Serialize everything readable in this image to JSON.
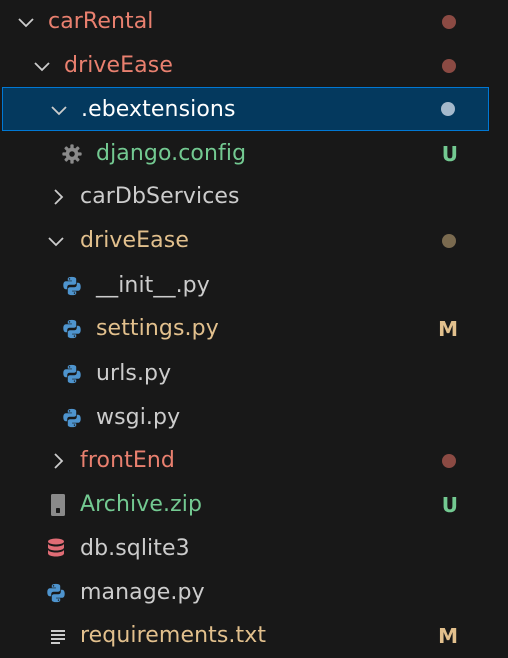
{
  "colors": {
    "background": "#181818",
    "text_default": "#cccccc",
    "text_conflict": "#e9806f",
    "text_modified": "#e2c08d",
    "text_untracked": "#73c991",
    "dot_conflict": "#8b4a43",
    "dot_modified": "#7a6a4f",
    "dot_selected": "#a5b9cc",
    "selection_bg": "#04395e",
    "selection_border": "#0078d4",
    "chevron": "#cccccc",
    "python_icon": "#4e94ce",
    "database_icon": "#e06c75"
  },
  "explorer": {
    "items": [
      {
        "label": "carRental",
        "kind": "folder",
        "expanded": true,
        "status": "conflict-dot",
        "icon": "chevron-down-icon"
      },
      {
        "label": "driveEase",
        "kind": "folder",
        "expanded": true,
        "status": "conflict-dot",
        "icon": "chevron-down-icon"
      },
      {
        "label": ".ebextensions",
        "kind": "folder",
        "expanded": true,
        "status": "selected-dot",
        "selected": true,
        "icon": "chevron-down-icon"
      },
      {
        "label": "django.config",
        "kind": "file",
        "status": "untracked",
        "badge": "U",
        "icon": "gear-icon"
      },
      {
        "label": "carDbServices",
        "kind": "folder",
        "expanded": false,
        "status": "none",
        "icon": "chevron-right-icon"
      },
      {
        "label": "driveEase",
        "kind": "folder",
        "expanded": true,
        "status": "modified-dot",
        "icon": "chevron-down-icon"
      },
      {
        "label": "__init__.py",
        "kind": "file",
        "status": "none",
        "icon": "python-icon"
      },
      {
        "label": "settings.py",
        "kind": "file",
        "status": "modified",
        "badge": "M",
        "icon": "python-icon"
      },
      {
        "label": "urls.py",
        "kind": "file",
        "status": "none",
        "icon": "python-icon"
      },
      {
        "label": "wsgi.py",
        "kind": "file",
        "status": "none",
        "icon": "python-icon"
      },
      {
        "label": "frontEnd",
        "kind": "folder",
        "expanded": false,
        "status": "conflict-dot",
        "icon": "chevron-right-icon"
      },
      {
        "label": "Archive.zip",
        "kind": "file",
        "status": "untracked",
        "badge": "U",
        "icon": "zip-icon"
      },
      {
        "label": "db.sqlite3",
        "kind": "file",
        "status": "none",
        "icon": "database-icon"
      },
      {
        "label": "manage.py",
        "kind": "file",
        "status": "none",
        "icon": "python-icon"
      },
      {
        "label": "requirements.txt",
        "kind": "file",
        "status": "modified",
        "badge": "M",
        "icon": "text-lines-icon"
      }
    ]
  }
}
